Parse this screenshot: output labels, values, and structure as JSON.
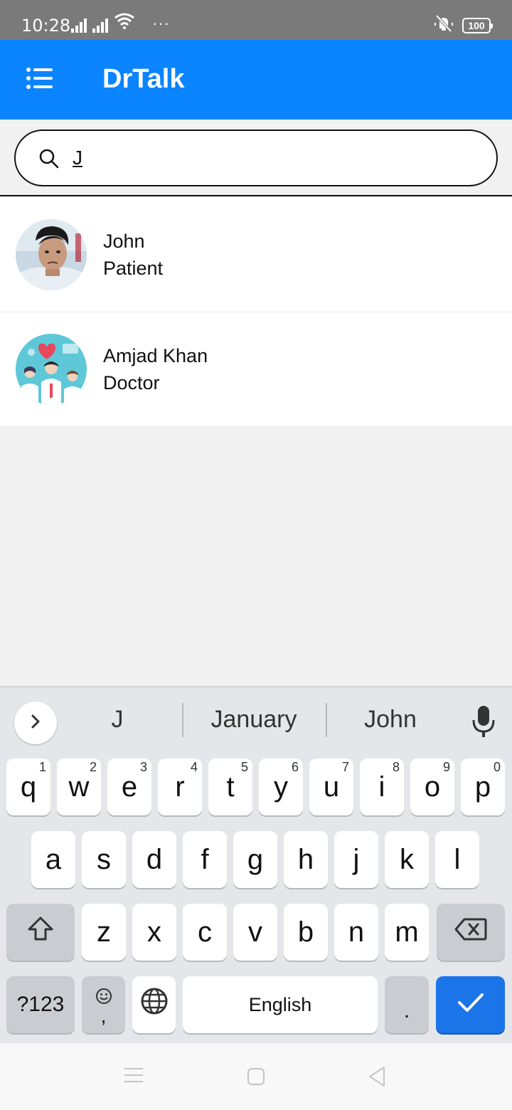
{
  "status_bar": {
    "time": "10:28",
    "more": "···",
    "battery": "100"
  },
  "app_bar": {
    "title": "DrTalk"
  },
  "search": {
    "value": "J"
  },
  "results": [
    {
      "name": "John",
      "role": "Patient"
    },
    {
      "name": "Amjad Khan",
      "role": "Doctor"
    }
  ],
  "keyboard": {
    "suggestions": [
      "J",
      "January",
      "John"
    ],
    "row1": [
      {
        "k": "q",
        "h": "1"
      },
      {
        "k": "w",
        "h": "2"
      },
      {
        "k": "e",
        "h": "3"
      },
      {
        "k": "r",
        "h": "4"
      },
      {
        "k": "t",
        "h": "5"
      },
      {
        "k": "y",
        "h": "6"
      },
      {
        "k": "u",
        "h": "7"
      },
      {
        "k": "i",
        "h": "8"
      },
      {
        "k": "o",
        "h": "9"
      },
      {
        "k": "p",
        "h": "0"
      }
    ],
    "row2": [
      "a",
      "s",
      "d",
      "f",
      "g",
      "h",
      "j",
      "k",
      "l"
    ],
    "row3": [
      "z",
      "x",
      "c",
      "v",
      "b",
      "n",
      "m"
    ],
    "symbols_label": "?123",
    "comma_label": ",",
    "space_label": "English",
    "period_label": "."
  },
  "colors": {
    "app_bar": "#0a84ff",
    "done_key": "#1b74e8",
    "status_bar": "#7a7a7a"
  }
}
